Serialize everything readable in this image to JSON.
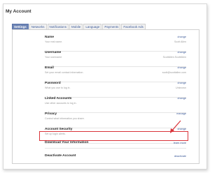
{
  "page": {
    "title": "My Account"
  },
  "tabs": [
    {
      "label": "Settings",
      "active": true
    },
    {
      "label": "Networks"
    },
    {
      "label": "Notifications"
    },
    {
      "label": "Mobile"
    },
    {
      "label": "Language"
    },
    {
      "label": "Payments"
    },
    {
      "label": "Facebook Ads"
    }
  ],
  "settings": [
    {
      "title": "Name",
      "desc": "Your real name.",
      "action": "change",
      "value": "Scott Allen"
    },
    {
      "title": "Username",
      "desc": "Your username",
      "action": "change",
      "value": "ScottAllen.ScottAllen"
    },
    {
      "title": "Email",
      "desc": "Set your email contact information.",
      "action": "change",
      "value": "scott@scottallen.com"
    },
    {
      "title": "Password",
      "desc": "What you use to log in.",
      "action": "change",
      "value": "Unknown"
    },
    {
      "title": "Linked Accounts",
      "desc": "Use other accounts to log in.",
      "action": "change",
      "value": ""
    },
    {
      "title": "Privacy",
      "desc": "Control what information you share.",
      "action": "manage",
      "value": ""
    },
    {
      "title": "Account Security",
      "desc": "Set up login alerts.",
      "action": "change",
      "value": ""
    },
    {
      "title": "Download Your Information",
      "desc": "",
      "action": "learn more",
      "value": ""
    },
    {
      "title": "Deactivate Account",
      "desc": "",
      "action": "deactivate",
      "value": ""
    }
  ],
  "colors": {
    "link": "#3b5998",
    "highlight": "#d9343a",
    "active_tab": "#6d84b4"
  }
}
